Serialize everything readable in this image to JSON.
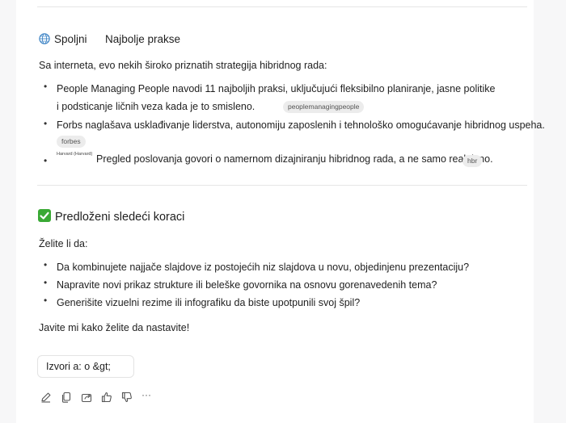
{
  "web_section": {
    "tab_label": "Spoljni",
    "heading": "Najbolje prakse",
    "intro": "Sa interneta, evo nekih široko priznatih strategija hibridnog rada:",
    "items": [
      {
        "bullet": "•",
        "line1": "People Managing People navodi 11 najboljih praksi, uključujući fleksibilno planiranje, jasne politike",
        "line2": "i podsticanje ličnih veza kada je to smisleno.",
        "chip": "peoplemanagingpeople"
      },
      {
        "bullet": "•",
        "line1": "Forbs naglašava usklađivanje liderstva, autonomiju zaposlenih i tehnološko omogućavanje hibridnog uspeha.",
        "chip": "forbes"
      },
      {
        "bullet": "•",
        "prefix": "Harvard (Harvard)",
        "line1": "Pregled poslovanja govori o namernom dizajniranju hibridnog rada, a ne samo reaktivno.",
        "chip": "hbr"
      }
    ]
  },
  "next_steps": {
    "heading": "Predloženi sledeći koraci",
    "prompt": "Želite li da:",
    "items": [
      "Da kombinujete najjače slajdove iz postojećih niz slajdova u novu, objedinjenu prezentaciju?",
      "Napravite novi prikaz strukture ili beleške govornika na osnovu gorenavedenih tema?",
      "Generišite vizuelni rezime ili infografiku da biste upotpunili svoj špil?"
    ],
    "bullet": "•",
    "closing": "Javite mi kako želite da nastavite!"
  },
  "sources_button": {
    "label": "Izvori a: o &gt;"
  },
  "actions": {
    "icons": [
      "edit-icon",
      "copy-icon",
      "share-icon",
      "thumbs-up-icon",
      "thumbs-down-icon",
      "more-icon"
    ],
    "more_label": "···"
  },
  "colors": {
    "accent_check": "#3aa935",
    "globe": "#3b82c4",
    "chip_bg": "#ececec"
  }
}
